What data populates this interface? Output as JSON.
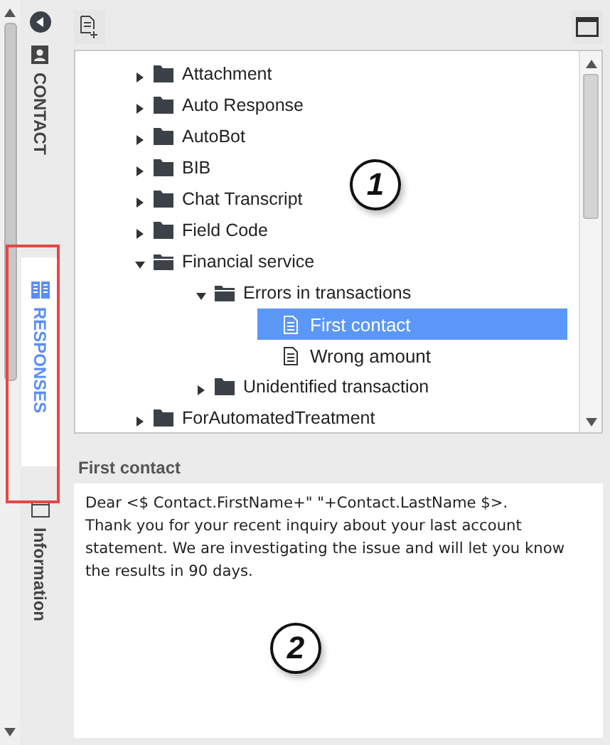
{
  "side_tabs": [
    {
      "kind": "contact",
      "label": "CONTACT",
      "selected": false
    },
    {
      "kind": "responses",
      "label": "RESPONSES",
      "selected": true
    },
    {
      "kind": "info",
      "label": "Information",
      "selected": false
    }
  ],
  "tree": [
    {
      "label": "Attachment",
      "kind": "folder",
      "expanded": false
    },
    {
      "label": "Auto Response",
      "kind": "folder",
      "expanded": false
    },
    {
      "label": "AutoBot",
      "kind": "folder",
      "expanded": false
    },
    {
      "label": "BIB",
      "kind": "folder",
      "expanded": false
    },
    {
      "label": "Chat Transcript",
      "kind": "folder",
      "expanded": false
    },
    {
      "label": "Field Code",
      "kind": "folder",
      "expanded": false
    },
    {
      "label": "Financial service",
      "kind": "folder",
      "expanded": true,
      "children": [
        {
          "label": "Errors in transactions",
          "kind": "folder",
          "expanded": true,
          "children": [
            {
              "label": "First contact",
              "kind": "response",
              "selected": true
            },
            {
              "label": "Wrong amount",
              "kind": "response",
              "selected": false
            }
          ]
        },
        {
          "label": "Unidentified transaction",
          "kind": "folder",
          "expanded": false
        }
      ]
    },
    {
      "label": "ForAutomatedTreatment",
      "kind": "folder",
      "expanded": false
    }
  ],
  "preview": {
    "title": "First contact",
    "body": "Dear <$ Contact.FirstName+\" \"+Contact.LastName $>.\nThank you for your recent inquiry about your last account statement. We are investigating the issue and will let you know the results in 90 days."
  },
  "callouts": [
    "1",
    "2"
  ]
}
